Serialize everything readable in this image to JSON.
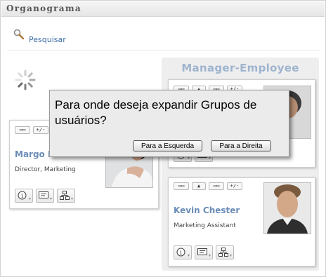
{
  "window": {
    "title": "Organograma"
  },
  "search": {
    "label": "Pesquisar"
  },
  "group": {
    "title": "Manager-Employee"
  },
  "toolbar": {
    "expand_label": "+/-"
  },
  "cards": [
    {
      "name": "Margo M",
      "title": "Director, Marketing"
    },
    {
      "name": "Kevin Chester",
      "title": "Marketing Assistant"
    }
  ],
  "dialog": {
    "message": "Para onde deseja expandir Grupos de usuários?",
    "left_button": "Para a Esquerda",
    "right_button": "Para a Direita"
  }
}
